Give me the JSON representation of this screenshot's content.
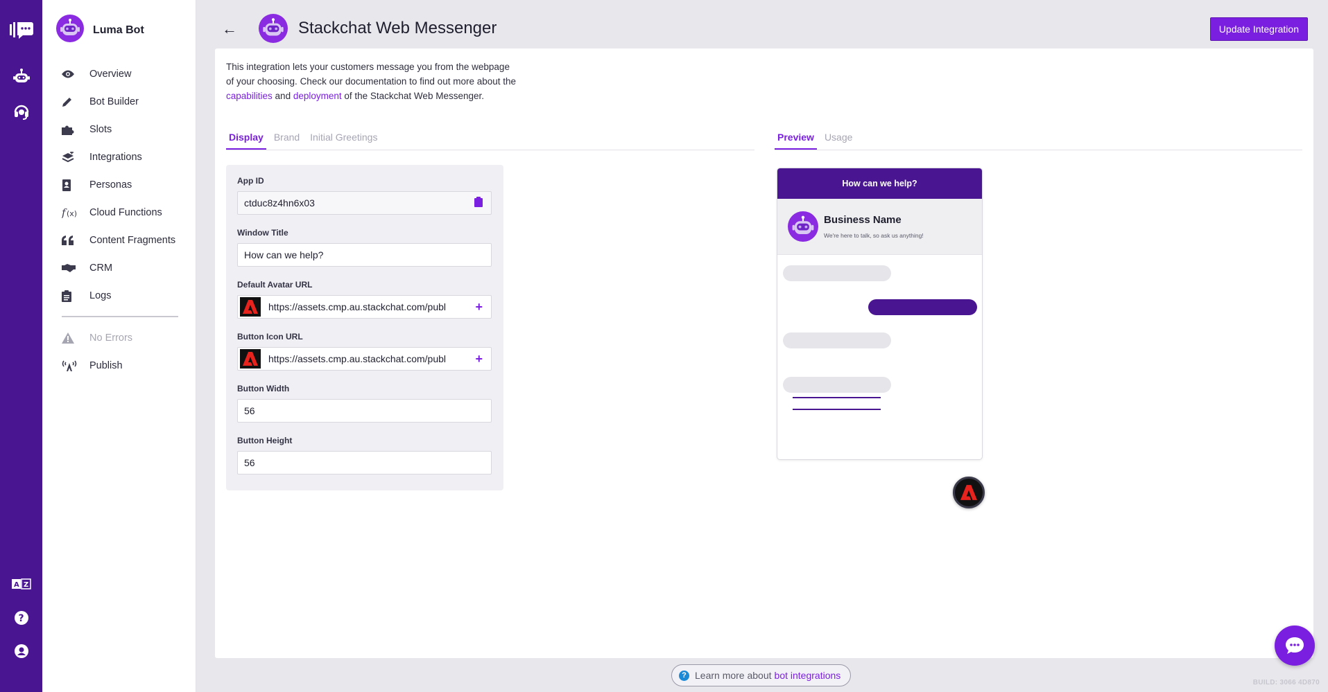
{
  "app": {
    "bot_name": "Luma Bot",
    "colors": {
      "rail": "#4a1590",
      "accent": "#7a1fe0"
    }
  },
  "rail": {
    "top_icons": [
      "stackchat-logo-icon",
      "bot-icon",
      "agent-headset-icon"
    ],
    "bottom_icons": [
      "translate-icon",
      "help-icon",
      "account-icon"
    ]
  },
  "sidebar": {
    "items": [
      {
        "label": "Overview",
        "icon": "eye-icon"
      },
      {
        "label": "Bot Builder",
        "icon": "pencil-icon"
      },
      {
        "label": "Slots",
        "icon": "puzzle-icon"
      },
      {
        "label": "Integrations",
        "icon": "layers-icon"
      },
      {
        "label": "Personas",
        "icon": "persona-icon"
      },
      {
        "label": "Cloud Functions",
        "icon": "function-icon"
      },
      {
        "label": "Content Fragments",
        "icon": "quote-icon"
      },
      {
        "label": "CRM",
        "icon": "handshake-icon"
      },
      {
        "label": "Logs",
        "icon": "clipboard-icon"
      }
    ],
    "status": {
      "label": "No Errors",
      "icon": "warning-icon"
    },
    "publish": {
      "label": "Publish",
      "icon": "broadcast-icon"
    }
  },
  "header": {
    "title": "Stackchat Web Messenger",
    "update_button": "Update Integration"
  },
  "intro": {
    "text_1": "This integration lets your customers message you from the webpage of your choosing. Check our documentation to find out more about the ",
    "link_1": "capabilities",
    "text_2": " and ",
    "link_2": "deployment",
    "text_3": " of the Stackchat Web Messenger."
  },
  "left_tabs": [
    "Display",
    "Brand",
    "Initial Greetings"
  ],
  "right_tabs": [
    "Preview",
    "Usage"
  ],
  "form": {
    "app_id": {
      "label": "App ID",
      "value": "ctduc8z4hn6x03"
    },
    "window_title": {
      "label": "Window Title",
      "value": "How can we help?"
    },
    "avatar_url": {
      "label": "Default Avatar URL",
      "value": "https://assets.cmp.au.stackchat.com/publ"
    },
    "button_icon_url": {
      "label": "Button Icon URL",
      "value": "https://assets.cmp.au.stackchat.com/publ"
    },
    "button_width": {
      "label": "Button Width",
      "value": "56"
    },
    "button_height": {
      "label": "Button Height",
      "value": "56"
    }
  },
  "preview": {
    "header": "How can we help?",
    "business_name": "Business Name",
    "business_sub": "We're here to talk, so ask us anything!"
  },
  "footer": {
    "learn_text": "Learn more about",
    "learn_link": "bot integrations",
    "build": "BUILD: 3066 4D870"
  }
}
